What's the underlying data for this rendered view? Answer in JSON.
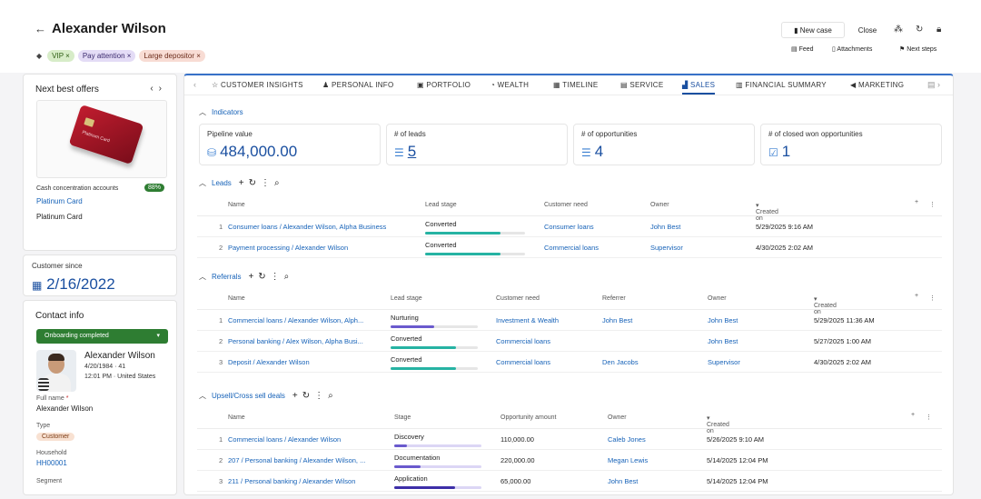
{
  "header": {
    "back_icon": "arrow-left-icon",
    "title": "Alexander Wilson",
    "tags": [
      "VIP",
      "Pay attention",
      "Large depositor"
    ],
    "new_case": "New case",
    "close": "Close",
    "actions": [
      "Feed",
      "Attachments",
      "Next steps"
    ]
  },
  "next_best_offers": {
    "title": "Next best offers",
    "card_text": "Platinum Card",
    "account_label": "Cash concentration accounts",
    "percent": "88%",
    "link": "Platinum Card",
    "plain": "Platinum Card"
  },
  "customer_since": {
    "label": "Customer since",
    "value": "2/16/2022"
  },
  "contact": {
    "title": "Contact info",
    "status": "Onboarding completed",
    "name": "Alexander Wilson",
    "dob": "4/20/1984 · 41",
    "time": "12:01 PM · United States",
    "full_name_label": "Full name",
    "full_name": "Alexander Wilson",
    "type_label": "Type",
    "type": "Customer",
    "household_label": "Household",
    "household": "HH00001",
    "segment_label": "Segment"
  },
  "tabs": [
    "CUSTOMER INSIGHTS",
    "PERSONAL INFO",
    "PORTFOLIO",
    "WEALTH",
    "TIMELINE",
    "SERVICE",
    "SALES",
    "FINANCIAL SUMMARY",
    "MARKETING"
  ],
  "active_tab": "SALES",
  "indicators": {
    "title": "Indicators",
    "items": [
      {
        "label": "Pipeline value",
        "value": "484,000.00",
        "icon": "coins-icon"
      },
      {
        "label": "# of leads",
        "value": "5",
        "icon": "filter-icon"
      },
      {
        "label": "# of opportunities",
        "value": "4",
        "icon": "filter-icon"
      },
      {
        "label": "# of closed won opportunities",
        "value": "1",
        "icon": "check-icon"
      }
    ]
  },
  "leads": {
    "title": "Leads",
    "columns": [
      "Name",
      "Lead stage",
      "Customer need",
      "Owner",
      "Created on"
    ],
    "rows": [
      {
        "num": "1",
        "name": "Consumer loans / Alexander Wilson, Alpha Business",
        "stage": "Converted",
        "progress": 0.75,
        "need": "Consumer loans",
        "owner": "John Best",
        "created": "5/29/2025 9:16 AM"
      },
      {
        "num": "2",
        "name": "Payment processing / Alexander Wilson",
        "stage": "Converted",
        "progress": 0.75,
        "need": "Commercial loans",
        "owner": "Supervisor",
        "created": "4/30/2025 2:02 AM"
      }
    ]
  },
  "referrals": {
    "title": "Referrals",
    "columns": [
      "Name",
      "Lead stage",
      "Customer need",
      "Referrer",
      "Owner",
      "Created on"
    ],
    "rows": [
      {
        "num": "1",
        "name": "Commercial loans / Alexander Wilson, Alph...",
        "stage": "Nurturing",
        "progress": 0.5,
        "need": "Investment & Wealth",
        "referrer": "John Best",
        "owner": "John Best",
        "created": "5/29/2025 11:36 AM"
      },
      {
        "num": "2",
        "name": "Personal banking / Alex Wilson, Alpha Busi...",
        "stage": "Converted",
        "progress": 0.75,
        "need": "Commercial loans",
        "referrer": "",
        "owner": "John Best",
        "created": "5/27/2025 1:00 AM"
      },
      {
        "num": "3",
        "name": "Deposit / Alexander Wilson",
        "stage": "Converted",
        "progress": 0.75,
        "need": "Commercial loans",
        "referrer": "Den Jacobs",
        "owner": "Supervisor",
        "created": "4/30/2025 2:02 AM"
      }
    ]
  },
  "deals": {
    "title": "Upsell/Cross sell deals",
    "columns": [
      "Name",
      "Stage",
      "Opportunity amount",
      "Owner",
      "Created on"
    ],
    "rows": [
      {
        "num": "1",
        "name": "Commercial loans / Alexander Wilson",
        "stage": "Discovery",
        "progress": 0.15,
        "amount": "110,000.00",
        "owner": "Caleb Jones",
        "created": "5/26/2025 9:10 AM"
      },
      {
        "num": "2",
        "name": "207 / Personal banking / Alexander Wilson, ...",
        "stage": "Documentation",
        "progress": 0.3,
        "amount": "220,000.00",
        "owner": "Megan Lewis",
        "created": "5/14/2025 12:04 PM"
      },
      {
        "num": "3",
        "name": "211 / Personal banking / Alexander Wilson",
        "stage": "Application",
        "progress": 0.7,
        "amount": "65,000.00",
        "owner": "John Best",
        "created": "5/14/2025 12:04 PM"
      }
    ]
  },
  "colors": {
    "accent": "#1a4fa0",
    "link": "#1662b8",
    "green": "#2e7d32",
    "teal": "#26b3a3",
    "purple": "#6a5acd"
  }
}
